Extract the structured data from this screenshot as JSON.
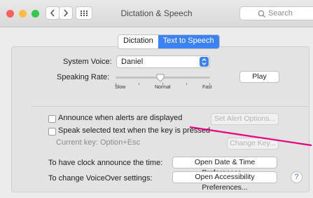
{
  "window": {
    "title": "Dictation & Speech",
    "search_placeholder": "Search"
  },
  "tabs": [
    {
      "label": "Dictation",
      "selected": false
    },
    {
      "label": "Text to Speech",
      "selected": true
    }
  ],
  "system_voice": {
    "label": "System Voice:",
    "value": "Daniel"
  },
  "speaking_rate": {
    "label": "Speaking Rate:",
    "slow": "Slow",
    "normal": "Normal",
    "fast": "Fast",
    "level_fraction": 0.45
  },
  "play_label": "Play",
  "alerts": {
    "label": "Announce when alerts are displayed",
    "checked": false,
    "button": "Set Alert Options..."
  },
  "speak_selected": {
    "label": "Speak selected text when the key is pressed",
    "checked": false,
    "current_key": "Current key: Option+Esc",
    "button": "Change Key..."
  },
  "clock": {
    "label": "To have clock announce the time:",
    "button": "Open Date & Time Preferences..."
  },
  "voiceover": {
    "label": "To change VoiceOver settings:",
    "button": "Open Accessibility Preferences..."
  },
  "help_label": "?",
  "colors": {
    "accent": "#3b82f6",
    "annotation": "#e5007e",
    "close": "#fc605c",
    "minimize": "#fdbc40",
    "zoom": "#34c84a"
  },
  "icons": [
    "chevron-left-icon",
    "chevron-right-icon",
    "grid-icon",
    "search-icon",
    "chevron-updown-icon",
    "help-icon"
  ]
}
